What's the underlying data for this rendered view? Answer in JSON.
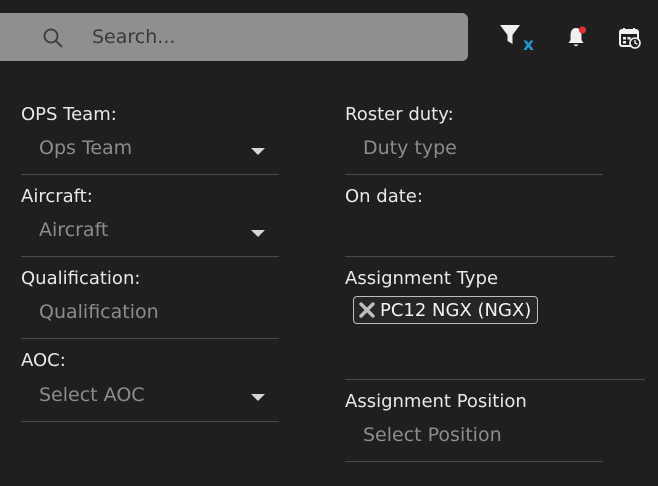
{
  "search": {
    "placeholder": "Search..."
  },
  "toolbar": {
    "filter_clear_icon": "filter-clear-icon",
    "filter_clear_badge": "x",
    "bell_icon": "bell-icon",
    "calendar_icon": "calendar-clock-icon",
    "accent_color": "#1e9bd7",
    "notification_color": "#e03030"
  },
  "left_filters": [
    {
      "label": "OPS Team:",
      "placeholder": "Ops Team",
      "has_dropdown": true
    },
    {
      "label": "Aircraft:",
      "placeholder": "Aircraft",
      "has_dropdown": true
    },
    {
      "label": "Qualification:",
      "placeholder": "Qualification",
      "has_dropdown": false
    },
    {
      "label": "AOC:",
      "placeholder": "Select AOC",
      "has_dropdown": true
    }
  ],
  "right_filters": {
    "roster_duty": {
      "label": "Roster duty:",
      "placeholder": "Duty type"
    },
    "on_date": {
      "label": "On date:",
      "value": ""
    },
    "assignment_type": {
      "label": "Assignment Type",
      "chips": [
        "PC12 NGX (NGX)"
      ]
    },
    "assignment_position": {
      "label": "Assignment Position",
      "placeholder": "Select Position"
    }
  }
}
